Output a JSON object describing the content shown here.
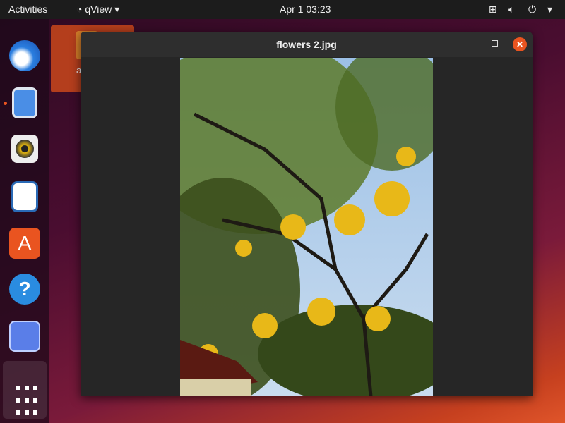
{
  "topbar": {
    "activities": "Activities",
    "app_menu": "qView",
    "clock": "Apr 1  03:23"
  },
  "desktop": {
    "file_label": "a"
  },
  "window": {
    "title": "flowers 2.jpg"
  },
  "dock": {
    "items": [
      "thunderbird",
      "files",
      "rhythmbox",
      "libreoffice-impress",
      "software",
      "help",
      "screenshot",
      "show-applications"
    ]
  },
  "colors": {
    "accent": "#e95420"
  }
}
